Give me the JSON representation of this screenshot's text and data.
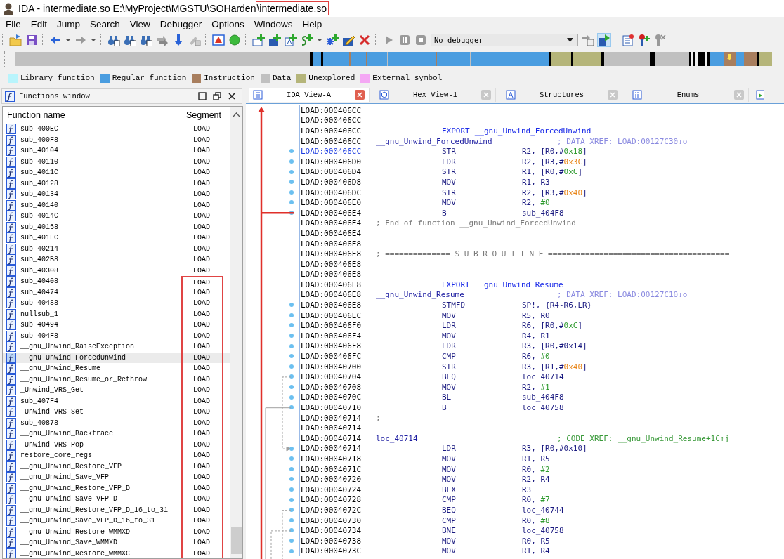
{
  "window": {
    "title": "IDA - intermediate.so E:\\MyProject\\MGSTU\\SOHarden",
    "highlighted_title_part": "\\intermediate.so"
  },
  "menu": [
    "File",
    "Edit",
    "Jump",
    "Search",
    "View",
    "Debugger",
    "Options",
    "Windows",
    "Help"
  ],
  "toolbar": {
    "debugger_select": "No debugger"
  },
  "legend": [
    {
      "label": "Library function",
      "color": "#b8f4fc"
    },
    {
      "label": "Regular function",
      "color": "#4a9de0"
    },
    {
      "label": "Instruction",
      "color": "#a87e5e"
    },
    {
      "label": "Data",
      "color": "#c0c0c0"
    },
    {
      "label": "Unexplored",
      "color": "#b5b57a"
    },
    {
      "label": "External symbol",
      "color": "#f4a8f4"
    }
  ],
  "functions_window": {
    "title": "Functions window",
    "columns": [
      "Function name",
      "Segment"
    ],
    "rows": [
      {
        "name": "sub_400EC",
        "segment": "LOAD",
        "selected": false,
        "marked": false
      },
      {
        "name": "sub_400F8",
        "segment": "LOAD",
        "selected": false,
        "marked": false
      },
      {
        "name": "sub_40104",
        "segment": "LOAD",
        "selected": false,
        "marked": false
      },
      {
        "name": "sub_40110",
        "segment": "LOAD",
        "selected": false,
        "marked": false
      },
      {
        "name": "sub_4011C",
        "segment": "LOAD",
        "selected": false,
        "marked": false
      },
      {
        "name": "sub_40128",
        "segment": "LOAD",
        "selected": false,
        "marked": false
      },
      {
        "name": "sub_40134",
        "segment": "LOAD",
        "selected": false,
        "marked": false
      },
      {
        "name": "sub_40140",
        "segment": "LOAD",
        "selected": false,
        "marked": false
      },
      {
        "name": "sub_4014C",
        "segment": "LOAD",
        "selected": false,
        "marked": false
      },
      {
        "name": "sub_40158",
        "segment": "LOAD",
        "selected": false,
        "marked": false
      },
      {
        "name": "sub_401FC",
        "segment": "LOAD",
        "selected": false,
        "marked": false
      },
      {
        "name": "sub_40214",
        "segment": "LOAD",
        "selected": false,
        "marked": false
      },
      {
        "name": "sub_402B8",
        "segment": "LOAD",
        "selected": false,
        "marked": false
      },
      {
        "name": "sub_40308",
        "segment": "LOAD",
        "selected": false,
        "marked": false
      },
      {
        "name": "sub_40408",
        "segment": "LOAD",
        "selected": false,
        "marked": true
      },
      {
        "name": "sub_40474",
        "segment": "LOAD",
        "selected": false,
        "marked": true
      },
      {
        "name": "sub_40488",
        "segment": "LOAD",
        "selected": false,
        "marked": true
      },
      {
        "name": "nullsub_1",
        "segment": "LOAD",
        "selected": false,
        "marked": true
      },
      {
        "name": "sub_40494",
        "segment": "LOAD",
        "selected": false,
        "marked": true
      },
      {
        "name": "sub_404F8",
        "segment": "LOAD",
        "selected": false,
        "marked": true
      },
      {
        "name": "__gnu_Unwind_RaiseException",
        "segment": "LOAD",
        "selected": false,
        "marked": true
      },
      {
        "name": "__gnu_Unwind_ForcedUnwind",
        "segment": "LOAD",
        "selected": true,
        "marked": true
      },
      {
        "name": "__gnu_Unwind_Resume",
        "segment": "LOAD",
        "selected": false,
        "marked": true
      },
      {
        "name": "__gnu_Unwind_Resume_or_Rethrow",
        "segment": "LOAD",
        "selected": false,
        "marked": true
      },
      {
        "name": "_Unwind_VRS_Get",
        "segment": "LOAD",
        "selected": false,
        "marked": true
      },
      {
        "name": "sub_407F4",
        "segment": "LOAD",
        "selected": false,
        "marked": true
      },
      {
        "name": "_Unwind_VRS_Set",
        "segment": "LOAD",
        "selected": false,
        "marked": true
      },
      {
        "name": "sub_40878",
        "segment": "LOAD",
        "selected": false,
        "marked": true
      },
      {
        "name": "__gnu_Unwind_Backtrace",
        "segment": "LOAD",
        "selected": false,
        "marked": true
      },
      {
        "name": "_Unwind_VRS_Pop",
        "segment": "LOAD",
        "selected": false,
        "marked": true
      },
      {
        "name": "restore_core_regs",
        "segment": "LOAD",
        "selected": false,
        "marked": true
      },
      {
        "name": "__gnu_Unwind_Restore_VFP",
        "segment": "LOAD",
        "selected": false,
        "marked": true
      },
      {
        "name": "__gnu_Unwind_Save_VFP",
        "segment": "LOAD",
        "selected": false,
        "marked": true
      },
      {
        "name": "__gnu_Unwind_Restore_VFP_D",
        "segment": "LOAD",
        "selected": false,
        "marked": true
      },
      {
        "name": "__gnu_Unwind_Save_VFP_D",
        "segment": "LOAD",
        "selected": false,
        "marked": true
      },
      {
        "name": "__gnu_Unwind_Restore_VFP_D_16_to_31",
        "segment": "LOAD",
        "selected": false,
        "marked": true
      },
      {
        "name": "__gnu_Unwind_Save_VFP_D_16_to_31",
        "segment": "LOAD",
        "selected": false,
        "marked": true
      },
      {
        "name": "__gnu_Unwind_Restore_WMMXD",
        "segment": "LOAD",
        "selected": false,
        "marked": true
      },
      {
        "name": "__gnu_Unwind_Save_WMMXD",
        "segment": "LOAD",
        "selected": false,
        "marked": true
      },
      {
        "name": "__gnu_Unwind_Restore_WMMXC",
        "segment": "LOAD",
        "selected": false,
        "marked": true
      }
    ]
  },
  "tabs": [
    {
      "label": "IDA View-A",
      "selected": true
    },
    {
      "label": "Hex View-1",
      "selected": false
    },
    {
      "label": "Structures",
      "selected": false
    },
    {
      "label": "Enums",
      "selected": false
    }
  ],
  "listing": [
    {
      "address": "LOAD:000406CC",
      "current": false,
      "kind": "blank"
    },
    {
      "address": "LOAD:000406CC",
      "current": false,
      "kind": "blank"
    },
    {
      "address": "LOAD:000406CC",
      "current": false,
      "kind": "export",
      "directive": "EXPORT",
      "symbol": "__gnu_Unwind_ForcedUnwind"
    },
    {
      "address": "LOAD:000406CC",
      "current": false,
      "kind": "label",
      "label": "__gnu_Unwind_ForcedUnwind",
      "xref": {
        "text": "; DATA XREF: LOAD:00127C30↓o",
        "kind": "data"
      }
    },
    {
      "address": "LOAD:000406CC",
      "current": true,
      "kind": "insn",
      "mnemonic": "STR",
      "operands": [
        {
          "text": "R2, [R0,#",
          "kind": "plain"
        },
        {
          "text": "0x18",
          "kind": "number"
        },
        {
          "text": "]",
          "kind": "plain"
        }
      ]
    },
    {
      "address": "LOAD:000406D0",
      "current": false,
      "kind": "insn",
      "mnemonic": "LDR",
      "operands": [
        {
          "text": "R2, [R3,#",
          "kind": "plain"
        },
        {
          "text": "0x3C",
          "kind": "offset"
        },
        {
          "text": "]",
          "kind": "plain"
        }
      ]
    },
    {
      "address": "LOAD:000406D4",
      "current": false,
      "kind": "insn",
      "mnemonic": "STR",
      "operands": [
        {
          "text": "R1, [R0,#",
          "kind": "plain"
        },
        {
          "text": "0xC",
          "kind": "number"
        },
        {
          "text": "]",
          "kind": "plain"
        }
      ]
    },
    {
      "address": "LOAD:000406D8",
      "current": false,
      "kind": "insn",
      "mnemonic": "MOV",
      "operands": [
        {
          "text": "R1, R3",
          "kind": "plain"
        }
      ]
    },
    {
      "address": "LOAD:000406DC",
      "current": false,
      "kind": "insn",
      "mnemonic": "STR",
      "operands": [
        {
          "text": "R2, [R3,#",
          "kind": "plain"
        },
        {
          "text": "0x40",
          "kind": "offset"
        },
        {
          "text": "]",
          "kind": "plain"
        }
      ]
    },
    {
      "address": "LOAD:000406E0",
      "current": false,
      "kind": "insn",
      "mnemonic": "MOV",
      "operands": [
        {
          "text": "R2, ",
          "kind": "plain"
        },
        {
          "text": "#0",
          "kind": "number"
        }
      ]
    },
    {
      "address": "LOAD:000406E4",
      "current": false,
      "kind": "insn",
      "mnemonic": "B",
      "operands": [
        {
          "text": "sub_404F8",
          "kind": "plain"
        }
      ]
    },
    {
      "address": "LOAD:000406E4",
      "current": false,
      "kind": "comment",
      "comment": "; End of function __gnu_Unwind_ForcedUnwind"
    },
    {
      "address": "LOAD:000406E4",
      "current": false,
      "kind": "blank"
    },
    {
      "address": "LOAD:000406E8",
      "current": false,
      "kind": "blank"
    },
    {
      "address": "LOAD:000406E8",
      "current": false,
      "kind": "comment",
      "comment": "; ============== S U B R O U T I N E ======================================="
    },
    {
      "address": "LOAD:000406E8",
      "current": false,
      "kind": "blank"
    },
    {
      "address": "LOAD:000406E8",
      "current": false,
      "kind": "blank"
    },
    {
      "address": "LOAD:000406E8",
      "current": false,
      "kind": "export",
      "directive": "EXPORT",
      "symbol": "__gnu_Unwind_Resume"
    },
    {
      "address": "LOAD:000406E8",
      "current": false,
      "kind": "label",
      "label": "__gnu_Unwind_Resume",
      "xref": {
        "text": "; DATA XREF: LOAD:00127C10↓o",
        "kind": "data"
      }
    },
    {
      "address": "LOAD:000406E8",
      "current": false,
      "kind": "insn",
      "mnemonic": "STMFD",
      "operands": [
        {
          "text": "SP!, {R4-R6,LR}",
          "kind": "plain"
        }
      ]
    },
    {
      "address": "LOAD:000406EC",
      "current": false,
      "kind": "insn",
      "mnemonic": "MOV",
      "operands": [
        {
          "text": "R5, R0",
          "kind": "plain"
        }
      ]
    },
    {
      "address": "LOAD:000406F0",
      "current": false,
      "kind": "insn",
      "mnemonic": "LDR",
      "operands": [
        {
          "text": "R6, [R0,#",
          "kind": "plain"
        },
        {
          "text": "0xC",
          "kind": "number"
        },
        {
          "text": "]",
          "kind": "plain"
        }
      ]
    },
    {
      "address": "LOAD:000406F4",
      "current": false,
      "kind": "insn",
      "mnemonic": "MOV",
      "operands": [
        {
          "text": "R4, R1",
          "kind": "plain"
        }
      ]
    },
    {
      "address": "LOAD:000406F8",
      "current": false,
      "kind": "insn",
      "mnemonic": "LDR",
      "operands": [
        {
          "text": "R3, [R0,#0x14]",
          "kind": "plain"
        }
      ]
    },
    {
      "address": "LOAD:000406FC",
      "current": false,
      "kind": "insn",
      "mnemonic": "CMP",
      "operands": [
        {
          "text": "R6, ",
          "kind": "plain"
        },
        {
          "text": "#0",
          "kind": "number"
        }
      ]
    },
    {
      "address": "LOAD:00040700",
      "current": false,
      "kind": "insn",
      "mnemonic": "STR",
      "operands": [
        {
          "text": "R3, [R1,#",
          "kind": "plain"
        },
        {
          "text": "0x40",
          "kind": "offset"
        },
        {
          "text": "]",
          "kind": "plain"
        }
      ]
    },
    {
      "address": "LOAD:00040704",
      "current": false,
      "kind": "insn",
      "mnemonic": "BEQ",
      "operands": [
        {
          "text": "loc_40714",
          "kind": "plain"
        }
      ]
    },
    {
      "address": "LOAD:00040708",
      "current": false,
      "kind": "insn",
      "mnemonic": "MOV",
      "operands": [
        {
          "text": "R2, ",
          "kind": "plain"
        },
        {
          "text": "#1",
          "kind": "number"
        }
      ]
    },
    {
      "address": "LOAD:0004070C",
      "current": false,
      "kind": "insn",
      "mnemonic": "BL",
      "operands": [
        {
          "text": "sub_404F8",
          "kind": "plain"
        }
      ]
    },
    {
      "address": "LOAD:00040710",
      "current": false,
      "kind": "insn",
      "mnemonic": "B",
      "operands": [
        {
          "text": "loc_40758",
          "kind": "plain"
        }
      ]
    },
    {
      "address": "LOAD:00040714",
      "current": false,
      "kind": "comment",
      "comment": "; ------------------------------------------------------------------------------"
    },
    {
      "address": "LOAD:00040714",
      "current": false,
      "kind": "blank"
    },
    {
      "address": "LOAD:00040714",
      "current": false,
      "kind": "label",
      "label": "loc_40714",
      "xref": {
        "text": "; CODE XREF: __gnu_Unwind_Resume+1C↑j",
        "kind": "code"
      }
    },
    {
      "address": "LOAD:00040714",
      "current": false,
      "kind": "insn",
      "mnemonic": "LDR",
      "operands": [
        {
          "text": "R3, [R0,#0x10]",
          "kind": "plain"
        }
      ]
    },
    {
      "address": "LOAD:00040718",
      "current": false,
      "kind": "insn",
      "mnemonic": "MOV",
      "operands": [
        {
          "text": "R1, R5",
          "kind": "plain"
        }
      ]
    },
    {
      "address": "LOAD:0004071C",
      "current": false,
      "kind": "insn",
      "mnemonic": "MOV",
      "operands": [
        {
          "text": "R0, ",
          "kind": "plain"
        },
        {
          "text": "#2",
          "kind": "number"
        }
      ]
    },
    {
      "address": "LOAD:00040720",
      "current": false,
      "kind": "insn",
      "mnemonic": "MOV",
      "operands": [
        {
          "text": "R2, R4",
          "kind": "plain"
        }
      ]
    },
    {
      "address": "LOAD:00040724",
      "current": false,
      "kind": "insn",
      "mnemonic": "BLX",
      "operands": [
        {
          "text": "R3",
          "kind": "plain"
        }
      ]
    },
    {
      "address": "LOAD:00040728",
      "current": false,
      "kind": "insn",
      "mnemonic": "CMP",
      "operands": [
        {
          "text": "R0, ",
          "kind": "plain"
        },
        {
          "text": "#7",
          "kind": "number"
        }
      ]
    },
    {
      "address": "LOAD:0004072C",
      "current": false,
      "kind": "insn",
      "mnemonic": "BEQ",
      "operands": [
        {
          "text": "loc_40744",
          "kind": "plain"
        }
      ]
    },
    {
      "address": "LOAD:00040730",
      "current": false,
      "kind": "insn",
      "mnemonic": "CMP",
      "operands": [
        {
          "text": "R0, ",
          "kind": "plain"
        },
        {
          "text": "#8",
          "kind": "number"
        }
      ]
    },
    {
      "address": "LOAD:00040734",
      "current": false,
      "kind": "insn",
      "mnemonic": "BNE",
      "operands": [
        {
          "text": "loc_40758",
          "kind": "plain"
        }
      ]
    },
    {
      "address": "LOAD:00040738",
      "current": false,
      "kind": "insn",
      "mnemonic": "MOV",
      "operands": [
        {
          "text": "R0, R5",
          "kind": "plain"
        }
      ]
    },
    {
      "address": "LOAD:0004073C",
      "current": false,
      "kind": "insn",
      "mnemonic": "MOV",
      "operands": [
        {
          "text": "R1, R4",
          "kind": "plain"
        }
      ]
    }
  ]
}
